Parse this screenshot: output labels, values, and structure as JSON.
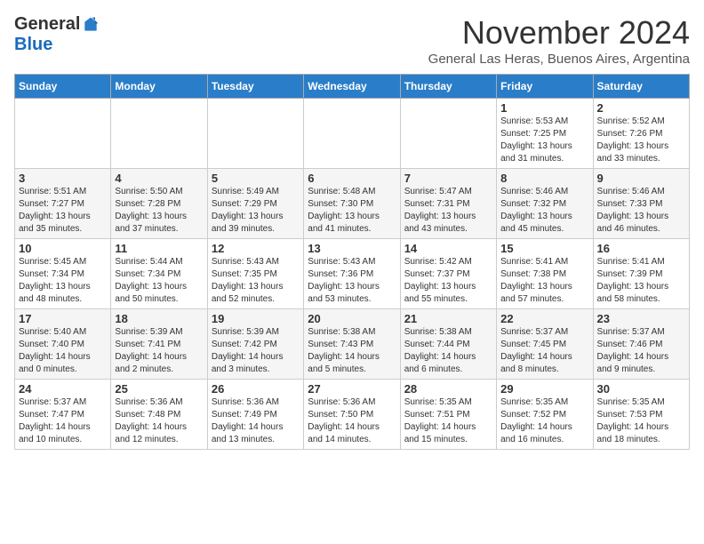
{
  "logo": {
    "general": "General",
    "blue": "Blue"
  },
  "header": {
    "month_title": "November 2024",
    "subtitle": "General Las Heras, Buenos Aires, Argentina"
  },
  "weekdays": [
    "Sunday",
    "Monday",
    "Tuesday",
    "Wednesday",
    "Thursday",
    "Friday",
    "Saturday"
  ],
  "weeks": [
    [
      {
        "day": "",
        "info": ""
      },
      {
        "day": "",
        "info": ""
      },
      {
        "day": "",
        "info": ""
      },
      {
        "day": "",
        "info": ""
      },
      {
        "day": "",
        "info": ""
      },
      {
        "day": "1",
        "info": "Sunrise: 5:53 AM\nSunset: 7:25 PM\nDaylight: 13 hours and 31 minutes."
      },
      {
        "day": "2",
        "info": "Sunrise: 5:52 AM\nSunset: 7:26 PM\nDaylight: 13 hours and 33 minutes."
      }
    ],
    [
      {
        "day": "3",
        "info": "Sunrise: 5:51 AM\nSunset: 7:27 PM\nDaylight: 13 hours and 35 minutes."
      },
      {
        "day": "4",
        "info": "Sunrise: 5:50 AM\nSunset: 7:28 PM\nDaylight: 13 hours and 37 minutes."
      },
      {
        "day": "5",
        "info": "Sunrise: 5:49 AM\nSunset: 7:29 PM\nDaylight: 13 hours and 39 minutes."
      },
      {
        "day": "6",
        "info": "Sunrise: 5:48 AM\nSunset: 7:30 PM\nDaylight: 13 hours and 41 minutes."
      },
      {
        "day": "7",
        "info": "Sunrise: 5:47 AM\nSunset: 7:31 PM\nDaylight: 13 hours and 43 minutes."
      },
      {
        "day": "8",
        "info": "Sunrise: 5:46 AM\nSunset: 7:32 PM\nDaylight: 13 hours and 45 minutes."
      },
      {
        "day": "9",
        "info": "Sunrise: 5:46 AM\nSunset: 7:33 PM\nDaylight: 13 hours and 46 minutes."
      }
    ],
    [
      {
        "day": "10",
        "info": "Sunrise: 5:45 AM\nSunset: 7:34 PM\nDaylight: 13 hours and 48 minutes."
      },
      {
        "day": "11",
        "info": "Sunrise: 5:44 AM\nSunset: 7:34 PM\nDaylight: 13 hours and 50 minutes."
      },
      {
        "day": "12",
        "info": "Sunrise: 5:43 AM\nSunset: 7:35 PM\nDaylight: 13 hours and 52 minutes."
      },
      {
        "day": "13",
        "info": "Sunrise: 5:43 AM\nSunset: 7:36 PM\nDaylight: 13 hours and 53 minutes."
      },
      {
        "day": "14",
        "info": "Sunrise: 5:42 AM\nSunset: 7:37 PM\nDaylight: 13 hours and 55 minutes."
      },
      {
        "day": "15",
        "info": "Sunrise: 5:41 AM\nSunset: 7:38 PM\nDaylight: 13 hours and 57 minutes."
      },
      {
        "day": "16",
        "info": "Sunrise: 5:41 AM\nSunset: 7:39 PM\nDaylight: 13 hours and 58 minutes."
      }
    ],
    [
      {
        "day": "17",
        "info": "Sunrise: 5:40 AM\nSunset: 7:40 PM\nDaylight: 14 hours and 0 minutes."
      },
      {
        "day": "18",
        "info": "Sunrise: 5:39 AM\nSunset: 7:41 PM\nDaylight: 14 hours and 2 minutes."
      },
      {
        "day": "19",
        "info": "Sunrise: 5:39 AM\nSunset: 7:42 PM\nDaylight: 14 hours and 3 minutes."
      },
      {
        "day": "20",
        "info": "Sunrise: 5:38 AM\nSunset: 7:43 PM\nDaylight: 14 hours and 5 minutes."
      },
      {
        "day": "21",
        "info": "Sunrise: 5:38 AM\nSunset: 7:44 PM\nDaylight: 14 hours and 6 minutes."
      },
      {
        "day": "22",
        "info": "Sunrise: 5:37 AM\nSunset: 7:45 PM\nDaylight: 14 hours and 8 minutes."
      },
      {
        "day": "23",
        "info": "Sunrise: 5:37 AM\nSunset: 7:46 PM\nDaylight: 14 hours and 9 minutes."
      }
    ],
    [
      {
        "day": "24",
        "info": "Sunrise: 5:37 AM\nSunset: 7:47 PM\nDaylight: 14 hours and 10 minutes."
      },
      {
        "day": "25",
        "info": "Sunrise: 5:36 AM\nSunset: 7:48 PM\nDaylight: 14 hours and 12 minutes."
      },
      {
        "day": "26",
        "info": "Sunrise: 5:36 AM\nSunset: 7:49 PM\nDaylight: 14 hours and 13 minutes."
      },
      {
        "day": "27",
        "info": "Sunrise: 5:36 AM\nSunset: 7:50 PM\nDaylight: 14 hours and 14 minutes."
      },
      {
        "day": "28",
        "info": "Sunrise: 5:35 AM\nSunset: 7:51 PM\nDaylight: 14 hours and 15 minutes."
      },
      {
        "day": "29",
        "info": "Sunrise: 5:35 AM\nSunset: 7:52 PM\nDaylight: 14 hours and 16 minutes."
      },
      {
        "day": "30",
        "info": "Sunrise: 5:35 AM\nSunset: 7:53 PM\nDaylight: 14 hours and 18 minutes."
      }
    ]
  ]
}
